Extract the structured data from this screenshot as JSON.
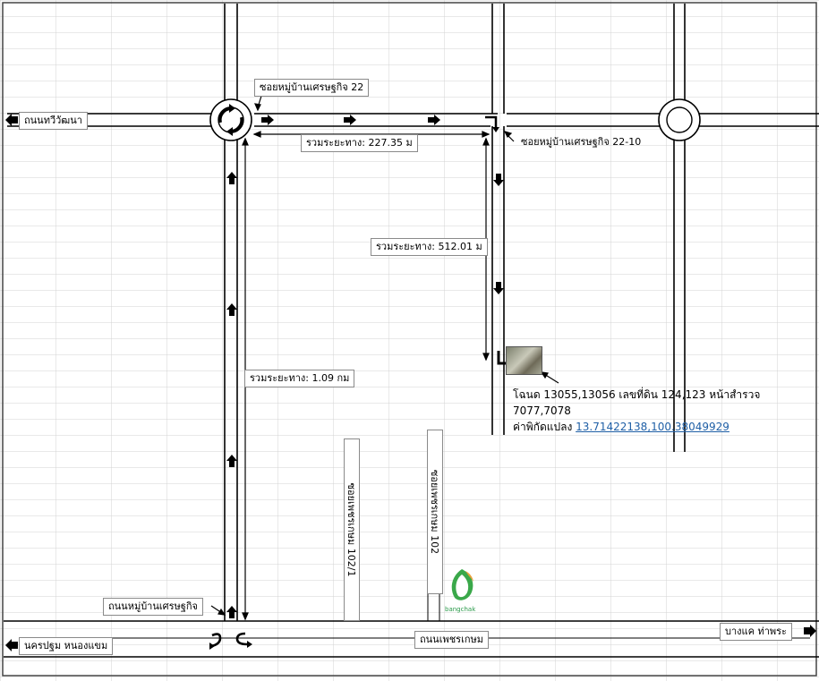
{
  "roads": {
    "thawi_watthana": "ถนนทวีวัฒนา",
    "nakhon_pathom": "นครปฐม หนองแขม",
    "bang_khae": "บางแค ท่าพระ",
    "phet_kasem": "ถนนเพชรเกษม",
    "village_road": "ถนนหมู่บ้านเศรษฐกิจ",
    "soi_22": "ซอยหมู่บ้านเศรษฐกิจ 22",
    "soi_22_10": "ซอยหมู่บ้านเศรษฐกิจ 22-10",
    "soi_102_1": "ซอยเพชรเกษม 102/1",
    "soi_102": "ซอยเพชรเกษม 102"
  },
  "distances": {
    "d1": "รวมระยะทาง: 227.35 ม",
    "d2": "รวมระยะทาง: 512.01 ม",
    "d3": "รวมระยะทาง: 1.09 กม"
  },
  "property": {
    "line1": "โฉนด 13055,13056 เลขที่ดิน 124,123 หน้าสำรวจ 7077,7078",
    "coords_prefix": "ค่าพิกัดแปลง",
    "coords_link": "13.71422138,100.38049929"
  },
  "landmark": {
    "name": "bangchak",
    "logo_color": "#3aa84a",
    "accent_color": "#e8a13a"
  },
  "colors": {
    "grid": "#d3d3d3",
    "road": "#000000",
    "link": "#1f5fa6"
  }
}
